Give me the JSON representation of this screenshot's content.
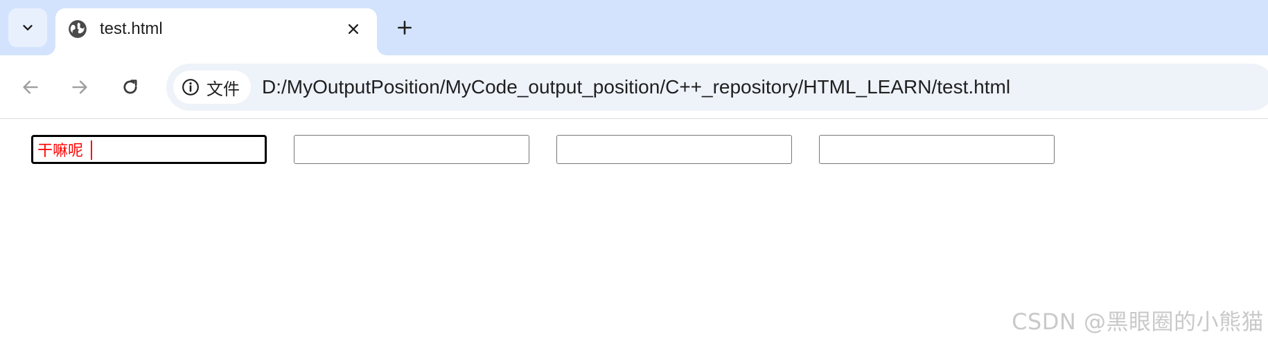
{
  "tabstrip": {
    "tab_search_icon": "chevron-down-icon",
    "active_tab": {
      "favicon": "globe-icon",
      "title": "test.html",
      "close_icon": "close-icon"
    },
    "new_tab_icon": "plus-icon"
  },
  "toolbar": {
    "back_icon": "arrow-left-icon",
    "forward_icon": "arrow-right-icon",
    "reload_icon": "reload-icon",
    "site_info": {
      "icon": "info-icon",
      "label": "文件"
    },
    "url": "D:/MyOutputPosition/MyCode_output_position/C++_repository/HTML_LEARN/test.html"
  },
  "page": {
    "inputs": [
      {
        "value": "干嘛呢",
        "text_color": "#ff0000",
        "focused": true
      },
      {
        "value": ""
      },
      {
        "value": ""
      },
      {
        "value": ""
      }
    ]
  },
  "watermark": "CSDN @黑眼圈的小熊猫",
  "colors": {
    "tabstrip_bg": "#d3e3fd",
    "omnibox_bg": "#eef2f9",
    "input_text": "#ff0000"
  }
}
